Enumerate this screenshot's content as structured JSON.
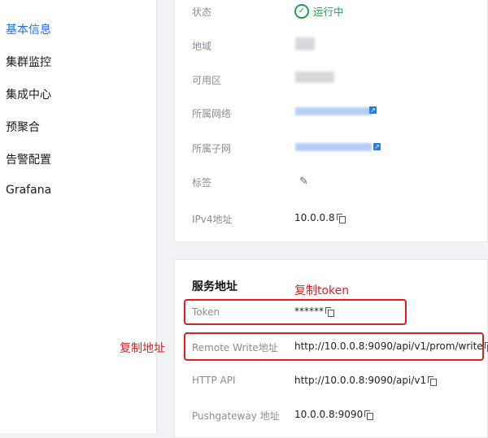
{
  "sidebar": {
    "items": [
      {
        "label": "基本信息",
        "active": true
      },
      {
        "label": "集群监控"
      },
      {
        "label": "集成中心"
      },
      {
        "label": "预聚合"
      },
      {
        "label": "告警配置"
      },
      {
        "label": "Grafana"
      }
    ]
  },
  "basic": {
    "status_label": "状态",
    "status_value": "运行中",
    "region_label": "地域",
    "zone_label": "可用区",
    "vpc_label": "所属网络",
    "subnet_label": "所属子网",
    "tag_label": "标签",
    "ipv4_label": "IPv4地址",
    "ipv4_value": "10.0.0.8"
  },
  "service": {
    "title": "服务地址",
    "token_label": "Token",
    "token_value": "******",
    "remote_write_label": "Remote Write地址",
    "remote_write_value": "http://10.0.0.8:9090/api/v1/prom/write",
    "http_api_label": "HTTP API",
    "http_api_value": "http://10.0.0.8:9090/api/v1",
    "pushgateway_label": "Pushgateway 地址",
    "pushgateway_value": "10.0.0.8:9090"
  },
  "annotations": {
    "copy_token": "复制token",
    "copy_address": "复制地址"
  },
  "colors": {
    "accent": "#1f6fe0",
    "status_ok": "#1aa34a",
    "annotation_red": "#e02020"
  },
  "icons": [
    "check-circle-icon",
    "external-link-icon",
    "edit-icon",
    "copy-icon"
  ]
}
